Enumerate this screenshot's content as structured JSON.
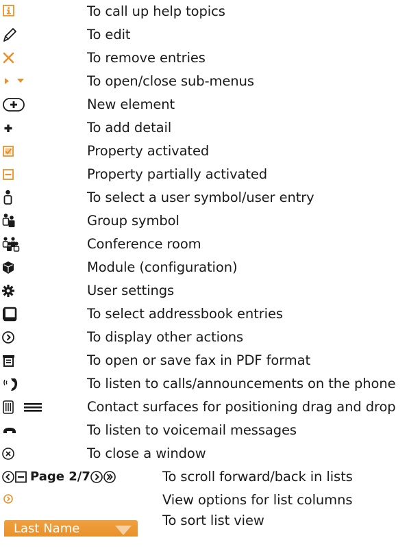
{
  "accent": "#e8912a",
  "ink": "#1a1a1a",
  "rows": [
    {
      "icon": "info-icon",
      "text": "To call up help topics"
    },
    {
      "icon": "pencil-icon",
      "text": "To edit"
    },
    {
      "icon": "cross-icon",
      "text": "To remove entries"
    },
    {
      "icon": "triangle-expand-collapse-icon",
      "text": "To open/close sub-menus"
    },
    {
      "icon": "circle-plus-icon",
      "text": "New element"
    },
    {
      "icon": "plus-icon",
      "text": "To add detail"
    },
    {
      "icon": "checkbox-checked-icon",
      "text": "Property activated"
    },
    {
      "icon": "checkbox-partial-icon",
      "text": "Property partially activated"
    },
    {
      "icon": "user-icon",
      "text": "To select a user symbol/user entry"
    },
    {
      "icon": "group-icon",
      "text": "Group symbol"
    },
    {
      "icon": "conference-room-icon",
      "text": "Conference room"
    },
    {
      "icon": "module-cube-icon",
      "text": "Module (configuration)"
    },
    {
      "icon": "gear-icon",
      "text": "User settings"
    },
    {
      "icon": "addressbook-icon",
      "text": "To select addressbook entries"
    },
    {
      "icon": "circle-chevron-right-icon",
      "text": "To display other actions"
    },
    {
      "icon": "fax-pdf-icon",
      "text": "To open or save fax in PDF format"
    },
    {
      "icon": "ringing-phone-icon",
      "text": "To listen to calls/announcements on the phone"
    },
    {
      "icon": "drag-handle-icon",
      "text": "Contact surfaces for positioning drag and drop"
    },
    {
      "icon": "handset-icon",
      "text": "To listen to voicemail messages"
    },
    {
      "icon": "close-circle-icon",
      "text": "To close a window"
    }
  ],
  "pager": {
    "label": "Page 2/7",
    "text": "To scroll forward/back in lists"
  },
  "column_options": {
    "icon": "orange-circle-chevron-icon",
    "text": "View options for list columns"
  },
  "sort": {
    "header_label": "Last Name",
    "text": "To sort list view"
  }
}
